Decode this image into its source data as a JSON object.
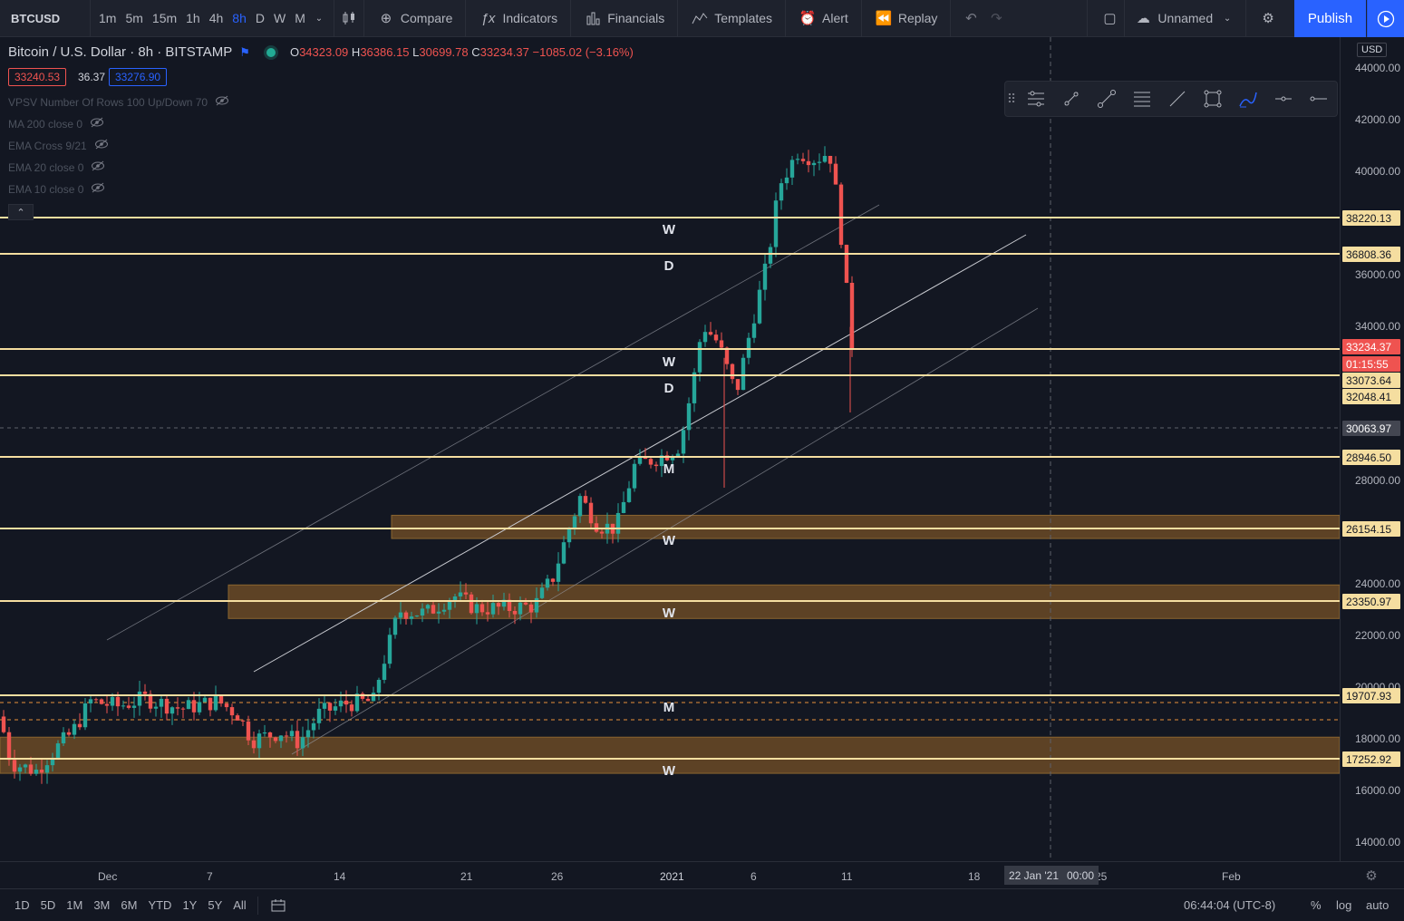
{
  "toolbar": {
    "symbol": "BTCUSD",
    "intervals": [
      "1m",
      "5m",
      "15m",
      "1h",
      "4h",
      "8h",
      "D",
      "W",
      "M"
    ],
    "active_interval": "8h",
    "compare": "Compare",
    "indicators": "Indicators",
    "financials": "Financials",
    "templates": "Templates",
    "alert": "Alert",
    "replay": "Replay",
    "layout_name": "Unnamed",
    "publish": "Publish"
  },
  "legend": {
    "title": "Bitcoin / U.S. Dollar · 8h · BITSTAMP",
    "o_label": "O",
    "o": "34323.09",
    "h_label": "H",
    "h": "36386.15",
    "l_label": "L",
    "l": "30699.78",
    "c_label": "C",
    "c": "33234.37",
    "change": "−1085.02 (−3.16%)",
    "bid": "33240.53",
    "spread": "36.37",
    "ask": "33276.90"
  },
  "indicators": [
    "VPSV Number Of Rows 100 Up/Down 70",
    "MA 200 close 0",
    "EMA Cross 9/21",
    "EMA 20 close 0",
    "EMA 10 close 0"
  ],
  "price_axis": {
    "currency": "USD",
    "ticks": [
      "44000.00",
      "42000.00",
      "40000.00",
      "36000.00",
      "34000.00",
      "28000.00",
      "24000.00",
      "22000.00",
      "20000.00",
      "18000.00",
      "16000.00",
      "14000.00"
    ],
    "badges": [
      "38220.13",
      "36808.36",
      "33234.37",
      "01:15:55",
      "33073.64",
      "32048.41",
      "30063.97",
      "28946.50",
      "26154.15",
      "23350.97",
      "19707.93",
      "17252.92"
    ]
  },
  "time_axis": {
    "ticks": [
      "Dec",
      "7",
      "14",
      "21",
      "26",
      "2021",
      "6",
      "11",
      "18",
      "25",
      "Feb"
    ],
    "crosshair_date": "22 Jan '21",
    "crosshair_time": "00:00"
  },
  "annotations": [
    "W",
    "D",
    "W",
    "D",
    "M",
    "W",
    "W",
    "M",
    "W"
  ],
  "bottom": {
    "ranges": [
      "1D",
      "5D",
      "1M",
      "3M",
      "6M",
      "YTD",
      "1Y",
      "5Y",
      "All"
    ],
    "clock": "06:44:04 (UTC-8)",
    "percent": "%",
    "log": "log",
    "auto": "auto"
  },
  "colors": {
    "up": "#26a69a",
    "down": "#ef5350",
    "level": "#f5dea0",
    "zone": "#6b4a26",
    "accent": "#2962ff"
  },
  "chart_data": {
    "type": "candlestick",
    "symbol": "BTCUSD",
    "interval": "8h",
    "horizontal_levels": [
      38220.13,
      36808.36,
      33234.37,
      33073.64,
      28946.5,
      26154.15,
      23350.97,
      19707.93,
      17252.92
    ],
    "zones": [
      [
        25800,
        26700
      ],
      [
        22700,
        24000
      ],
      [
        16700,
        18100
      ]
    ],
    "ylim": [
      13500,
      45000
    ]
  }
}
